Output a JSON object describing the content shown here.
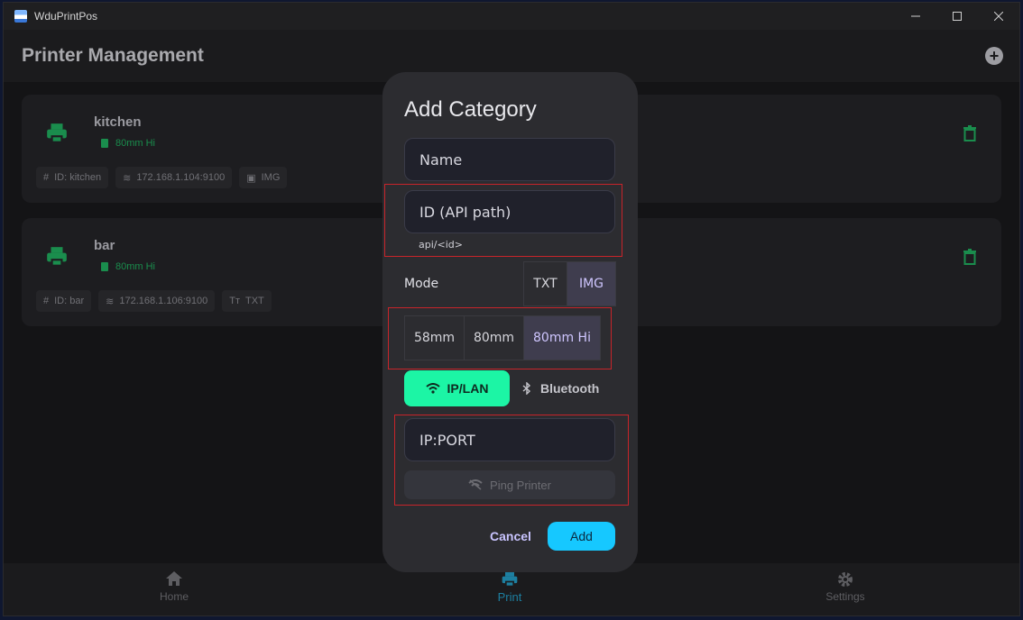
{
  "window": {
    "title": "WduPrintPos"
  },
  "header": {
    "title": "Printer Management"
  },
  "printers": [
    {
      "name": "kitchen",
      "size": "80mm Hi",
      "id": "ID: kitchen",
      "address": "172.168.1.104:9100",
      "mode": "IMG"
    },
    {
      "name": "bar",
      "size": "80mm Hi",
      "id": "ID: bar",
      "address": "172.168.1.106:9100",
      "mode": "TXT"
    }
  ],
  "nav": [
    {
      "label": "Home",
      "icon": "home-icon"
    },
    {
      "label": "Print",
      "icon": "printer-icon",
      "active": true
    },
    {
      "label": "Settings",
      "icon": "gear-icon"
    }
  ],
  "dialog": {
    "title": "Add Category",
    "name_placeholder": "Name",
    "id_placeholder": "ID (API path)",
    "id_helper": "api/<id>",
    "mode_label": "Mode",
    "mode_options": [
      "TXT",
      "IMG"
    ],
    "mode_selected": "IMG",
    "paper_options": [
      "58mm",
      "80mm",
      "80mm Hi"
    ],
    "paper_selected": "80mm Hi",
    "conn_ip": "IP/LAN",
    "conn_bt": "Bluetooth",
    "ip_placeholder": "IP:PORT",
    "ping_label": "Ping Printer",
    "cancel_label": "Cancel",
    "add_label": "Add"
  },
  "colors": {
    "accent_green": "#1cf5a5",
    "accent_cyan": "#16c8ff",
    "highlight_red": "#c8242a"
  }
}
